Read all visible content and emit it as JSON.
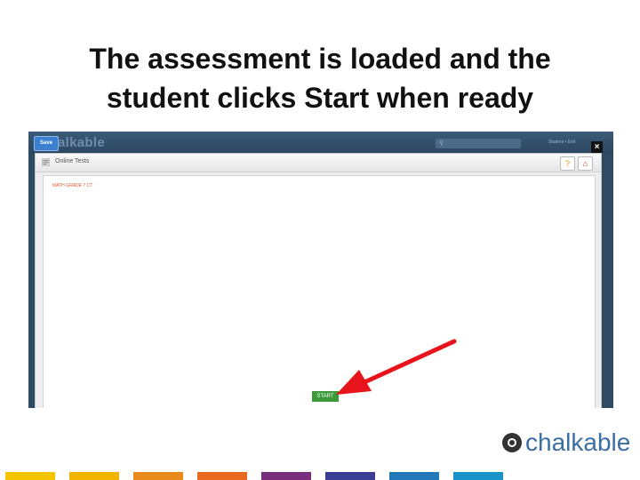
{
  "slide": {
    "title_line1": "The assessment is loaded and the",
    "title_line2": "student clicks Start when ready"
  },
  "app": {
    "save_label": "Save",
    "logo_text": "alkable",
    "user_text": "Student • Exit",
    "close_glyph": "×"
  },
  "panel": {
    "title": "Online Tests",
    "test_name": "MATH GRADE 7 CT",
    "start_label": "START",
    "hint_glyph": "?",
    "home_glyph": "⌂"
  },
  "brand": {
    "text": "chalkable"
  },
  "colors": {
    "bars": [
      "#f5c400",
      "#f1b400",
      "#e98a1c",
      "#e86a1e",
      "#7a2f7c",
      "#3a3f95",
      "#2277b8",
      "#1a93c9"
    ]
  }
}
